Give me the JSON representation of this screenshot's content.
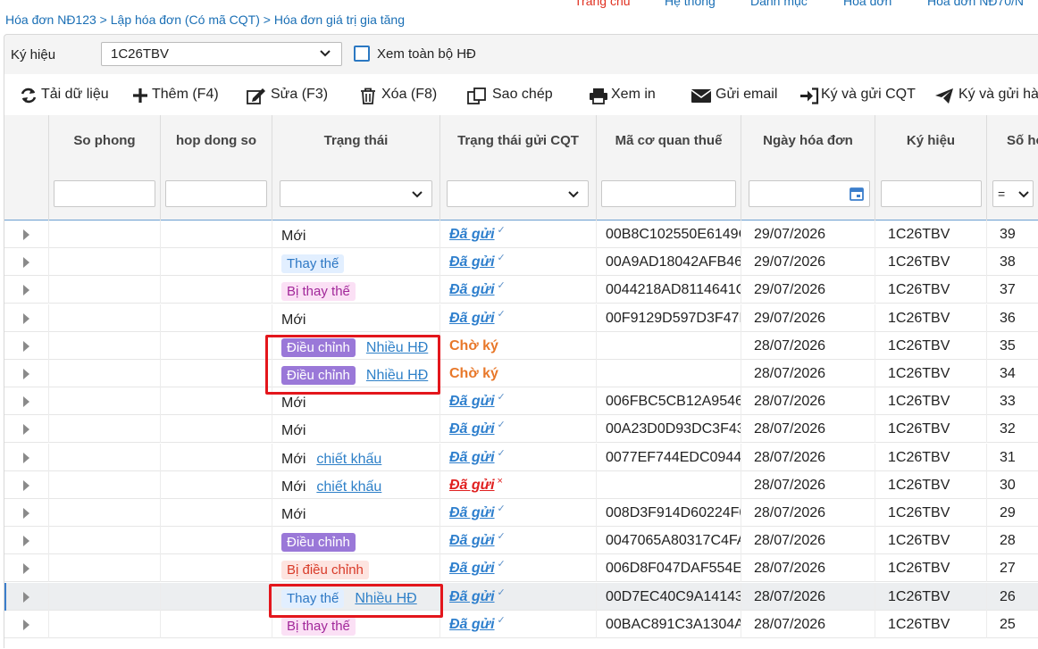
{
  "breadcrumb": "Hóa đơn NĐ123 > Lập hóa đơn (Có mã CQT) > Hóa đơn giá trị gia tăng",
  "topnav": [
    "Trang chủ",
    "Hệ thống",
    "Danh mục",
    "Hóa đơn",
    "Hóa đơn NĐ70/N"
  ],
  "filter": {
    "kyhieu_label": "Ký hiệu",
    "kyhieu_value": "1C26TBV",
    "view_all_label": "Xem toàn bộ HĐ"
  },
  "toolbar": {
    "reload": "Tải dữ liệu",
    "add": "Thêm (F4)",
    "edit": "Sửa (F3)",
    "delete": "Xóa (F8)",
    "copy": "Sao chép",
    "print": "Xem in",
    "email": "Gửi email",
    "sign_send": "Ký và gửi CQT",
    "sign_send_more": "Ký và gửi hà"
  },
  "columns": {
    "so_phong": "So phong",
    "hop_dong_so": "hop dong so",
    "trang_thai": "Trạng thái",
    "trang_thai_cqt": "Trạng thái gửi CQT",
    "ma_cqt": "Mã cơ quan thuế",
    "ngay_hd": "Ngày hóa đơn",
    "ky_hieu": "Ký hiệu",
    "so_hd": "Số hó",
    "so_filter_op": "="
  },
  "rows": [
    {
      "status": "Mới",
      "status_type": "moi",
      "link": "",
      "cqt": "Đã gửi",
      "cqt_type": "sent",
      "mark": "✓",
      "ma": "00B8C102550E6149C",
      "date": "29/07/2026",
      "kh": "1C26TBV",
      "so": "39"
    },
    {
      "status": "Thay thế",
      "status_type": "thay",
      "link": "",
      "cqt": "Đã gửi",
      "cqt_type": "sent",
      "mark": "✓",
      "ma": "00A9AD18042AFB46",
      "date": "29/07/2026",
      "kh": "1C26TBV",
      "so": "38"
    },
    {
      "status": "Bị thay thế",
      "status_type": "bithay",
      "link": "",
      "cqt": "Đã gửi",
      "cqt_type": "sent",
      "mark": "✓",
      "ma": "0044218AD8114641C",
      "date": "29/07/2026",
      "kh": "1C26TBV",
      "so": "37"
    },
    {
      "status": "Mới",
      "status_type": "moi",
      "link": "",
      "cqt": "Đã gửi",
      "cqt_type": "sent",
      "mark": "✓",
      "ma": "00F9129D597D3F47E",
      "date": "29/07/2026",
      "kh": "1C26TBV",
      "so": "36"
    },
    {
      "status": "Điều chỉnh",
      "status_type": "dieu",
      "link": "Nhiều HĐ",
      "cqt": "Chờ ký",
      "cqt_type": "pending",
      "mark": "",
      "ma": "",
      "date": "28/07/2026",
      "kh": "1C26TBV",
      "so": "35"
    },
    {
      "status": "Điều chỉnh",
      "status_type": "dieu",
      "link": "Nhiều HĐ",
      "cqt": "Chờ ký",
      "cqt_type": "pending",
      "mark": "",
      "ma": "",
      "date": "28/07/2026",
      "kh": "1C26TBV",
      "so": "34"
    },
    {
      "status": "Mới",
      "status_type": "moi",
      "link": "",
      "cqt": "Đã gửi",
      "cqt_type": "sent",
      "mark": "✓",
      "ma": "006FBC5CB12A9546",
      "date": "28/07/2026",
      "kh": "1C26TBV",
      "so": "33"
    },
    {
      "status": "Mới",
      "status_type": "moi",
      "link": "",
      "cqt": "Đã gửi",
      "cqt_type": "sent",
      "mark": "✓",
      "ma": "00A23D0D93DC3F43",
      "date": "28/07/2026",
      "kh": "1C26TBV",
      "so": "32"
    },
    {
      "status": "Mới",
      "status_type": "moi",
      "link": "chiết khấu",
      "cqt": "Đã gửi",
      "cqt_type": "sent",
      "mark": "✓",
      "ma": "0077EF744EDC0944",
      "date": "28/07/2026",
      "kh": "1C26TBV",
      "so": "31"
    },
    {
      "status": "Mới",
      "status_type": "moi",
      "link": "chiết khấu",
      "cqt": "Đã gửi",
      "cqt_type": "error",
      "mark": "×",
      "ma": "",
      "date": "28/07/2026",
      "kh": "1C26TBV",
      "so": "30"
    },
    {
      "status": "Mới",
      "status_type": "moi",
      "link": "",
      "cqt": "Đã gửi",
      "cqt_type": "sent",
      "mark": "✓",
      "ma": "008D3F914D60224F0",
      "date": "28/07/2026",
      "kh": "1C26TBV",
      "so": "29"
    },
    {
      "status": "Điều chỉnh",
      "status_type": "dieu",
      "link": "",
      "cqt": "Đã gửi",
      "cqt_type": "sent",
      "mark": "✓",
      "ma": "0047065A80317C4FA",
      "date": "28/07/2026",
      "kh": "1C26TBV",
      "so": "28"
    },
    {
      "status": "Bị điều chỉnh",
      "status_type": "bidieu",
      "link": "",
      "cqt": "Đã gửi",
      "cqt_type": "sent",
      "mark": "✓",
      "ma": "006D8F047DAF554E9",
      "date": "28/07/2026",
      "kh": "1C26TBV",
      "so": "27"
    },
    {
      "status": "Thay thế",
      "status_type": "thay",
      "link": "Nhiều HĐ",
      "cqt": "Đã gửi",
      "cqt_type": "sent",
      "mark": "✓",
      "ma": "00D7EC40C9A14143",
      "date": "28/07/2026",
      "kh": "1C26TBV",
      "so": "26"
    },
    {
      "status": "Bị thay thế",
      "status_type": "bithay",
      "link": "",
      "cqt": "Đã gửi",
      "cqt_type": "sent",
      "mark": "✓",
      "ma": "00BAC891C3A1304A",
      "date": "28/07/2026",
      "kh": "1C26TBV",
      "so": "25"
    }
  ],
  "selected_row": 13
}
